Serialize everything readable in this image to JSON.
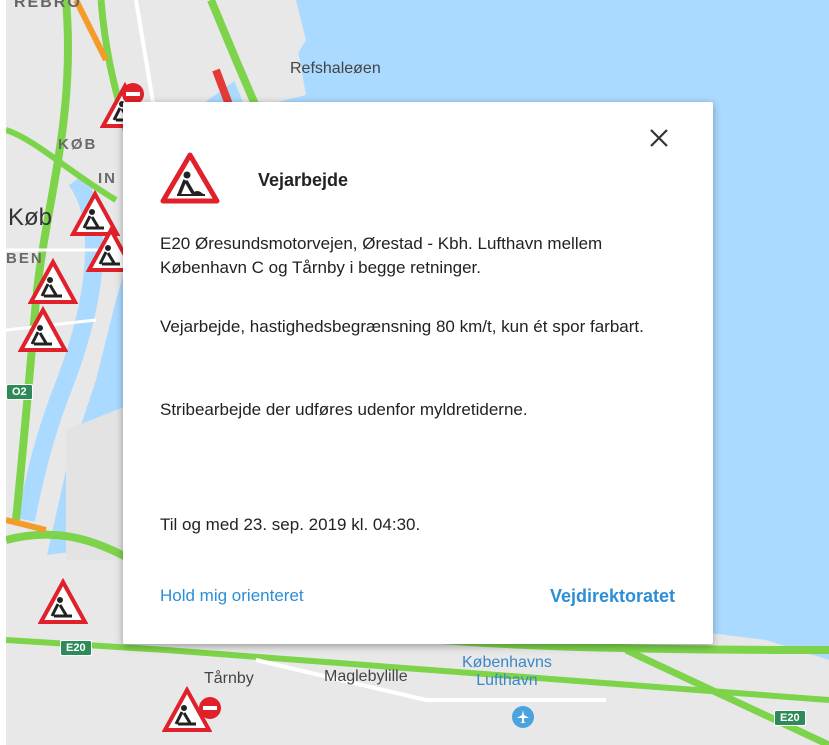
{
  "map": {
    "labels": {
      "refshaleoen": "Refshaleøen",
      "kobenhavn": "Køb",
      "kob_district": "KØB",
      "in_district": "IN",
      "be_district": "BEN",
      "tarnby": "Tårnby",
      "maglebylille": "Maglebylille",
      "airport_line1": "Københavns",
      "airport_line2": "Lufthavn",
      "top_partial": "REBRO"
    },
    "shields": {
      "e20_left": "E20",
      "e20_right": "E20",
      "o2": "O2"
    },
    "colors": {
      "water": "#aadaff",
      "land": "#e8e8e8",
      "road_green": "#7dd44a",
      "road_red": "#e53935",
      "road_orange": "#f39c2a",
      "marker_red": "#e0202a"
    }
  },
  "popup": {
    "icon": "roadwork-warning-icon",
    "title": "Vejarbejde",
    "paragraph1": "E20 Øresundsmotorvejen, Ørestad - Kbh. Lufthavn mellem København C og Tårnby i begge retninger.",
    "paragraph2": "Vejarbejde, hastighedsbegrænsning 80 km/t, kun ét spor farbart.",
    "paragraph3": "Stribearbejde der udføres udenfor myldretiderne.",
    "validity": "Til og med 23. sep. 2019 kl. 04:30.",
    "link_follow": "Hold mig orienteret",
    "link_agency": "Vejdirektoratet"
  }
}
